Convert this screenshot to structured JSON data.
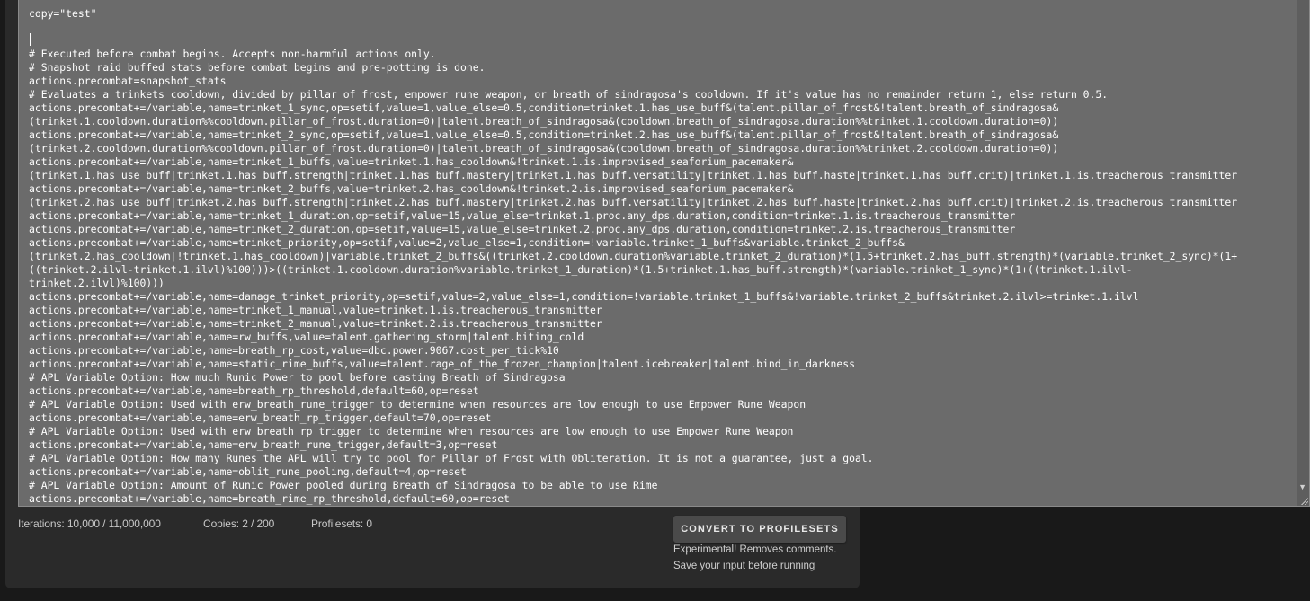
{
  "editor": {
    "lines": [
      "copy=\"test\"",
      "",
      "",
      "# Executed before combat begins. Accepts non-harmful actions only.",
      "# Snapshot raid buffed stats before combat begins and pre-potting is done.",
      "actions.precombat=snapshot_stats",
      "# Evaluates a trinkets cooldown, divided by pillar of frost, empower rune weapon, or breath of sindragosa's cooldown. If it's value has no remainder return 1, else return 0.5.",
      "actions.precombat+=/variable,name=trinket_1_sync,op=setif,value=1,value_else=0.5,condition=trinket.1.has_use_buff&(talent.pillar_of_frost&!talent.breath_of_sindragosa&",
      "(trinket.1.cooldown.duration%%cooldown.pillar_of_frost.duration=0)|talent.breath_of_sindragosa&(cooldown.breath_of_sindragosa.duration%%trinket.1.cooldown.duration=0))",
      "actions.precombat+=/variable,name=trinket_2_sync,op=setif,value=1,value_else=0.5,condition=trinket.2.has_use_buff&(talent.pillar_of_frost&!talent.breath_of_sindragosa&",
      "(trinket.2.cooldown.duration%%cooldown.pillar_of_frost.duration=0)|talent.breath_of_sindragosa&(cooldown.breath_of_sindragosa.duration%%trinket.2.cooldown.duration=0))",
      "actions.precombat+=/variable,name=trinket_1_buffs,value=trinket.1.has_cooldown&!trinket.1.is.improvised_seaforium_pacemaker&",
      "(trinket.1.has_use_buff|trinket.1.has_buff.strength|trinket.1.has_buff.mastery|trinket.1.has_buff.versatility|trinket.1.has_buff.haste|trinket.1.has_buff.crit)|trinket.1.is.treacherous_transmitter",
      "actions.precombat+=/variable,name=trinket_2_buffs,value=trinket.2.has_cooldown&!trinket.2.is.improvised_seaforium_pacemaker&",
      "(trinket.2.has_use_buff|trinket.2.has_buff.strength|trinket.2.has_buff.mastery|trinket.2.has_buff.versatility|trinket.2.has_buff.haste|trinket.2.has_buff.crit)|trinket.2.is.treacherous_transmitter",
      "actions.precombat+=/variable,name=trinket_1_duration,op=setif,value=15,value_else=trinket.1.proc.any_dps.duration,condition=trinket.1.is.treacherous_transmitter",
      "actions.precombat+=/variable,name=trinket_2_duration,op=setif,value=15,value_else=trinket.2.proc.any_dps.duration,condition=trinket.2.is.treacherous_transmitter",
      "actions.precombat+=/variable,name=trinket_priority,op=setif,value=2,value_else=1,condition=!variable.trinket_1_buffs&variable.trinket_2_buffs&",
      "(trinket.2.has_cooldown|!trinket.1.has_cooldown)|variable.trinket_2_buffs&((trinket.2.cooldown.duration%variable.trinket_2_duration)*(1.5+trinket.2.has_buff.strength)*(variable.trinket_2_sync)*(1+",
      "((trinket.2.ilvl-trinket.1.ilvl)%100)))>((trinket.1.cooldown.duration%variable.trinket_1_duration)*(1.5+trinket.1.has_buff.strength)*(variable.trinket_1_sync)*(1+((trinket.1.ilvl-",
      "trinket.2.ilvl)%100)))",
      "actions.precombat+=/variable,name=damage_trinket_priority,op=setif,value=2,value_else=1,condition=!variable.trinket_1_buffs&!variable.trinket_2_buffs&trinket.2.ilvl>=trinket.1.ilvl",
      "actions.precombat+=/variable,name=trinket_1_manual,value=trinket.1.is.treacherous_transmitter",
      "actions.precombat+=/variable,name=trinket_2_manual,value=trinket.2.is.treacherous_transmitter",
      "actions.precombat+=/variable,name=rw_buffs,value=talent.gathering_storm|talent.biting_cold",
      "actions.precombat+=/variable,name=breath_rp_cost,value=dbc.power.9067.cost_per_tick%10",
      "actions.precombat+=/variable,name=static_rime_buffs,value=talent.rage_of_the_frozen_champion|talent.icebreaker|talent.bind_in_darkness",
      "# APL Variable Option: How much Runic Power to pool before casting Breath of Sindragosa",
      "actions.precombat+=/variable,name=breath_rp_threshold,default=60,op=reset",
      "# APL Variable Option: Used with erw_breath_rune_trigger to determine when resources are low enough to use Empower Rune Weapon",
      "actions.precombat+=/variable,name=erw_breath_rp_trigger,default=70,op=reset",
      "# APL Variable Option: Used with erw_breath_rp_trigger to determine when resources are low enough to use Empower Rune Weapon",
      "actions.precombat+=/variable,name=erw_breath_rune_trigger,default=3,op=reset",
      "# APL Variable Option: How many Runes the APL will try to pool for Pillar of Frost with Obliteration. It is not a guarantee, just a goal.",
      "actions.precombat+=/variable,name=oblit_rune_pooling,default=4,op=reset",
      "# APL Variable Option: Amount of Runic Power pooled during Breath of Sindragosa to be able to use Rime",
      "actions.precombat+=/variable,name=breath_rime_rp_threshold,default=60,op=reset"
    ]
  },
  "stats": {
    "iterations": "Iterations: 10,000 / 11,000,000",
    "copies": "Copies: 2 / 200",
    "profilesets": "Profilesets: 0"
  },
  "convert": {
    "label": "CONVERT TO PROFILESETS",
    "note1": "Experimental! Removes comments.",
    "note2": "Save your input before running"
  },
  "colors": {
    "editor_bg": "#6b6b6b",
    "page_bg": "#191919",
    "panel_bg": "#2a2a2a",
    "button_bg": "#4a4a4a"
  }
}
